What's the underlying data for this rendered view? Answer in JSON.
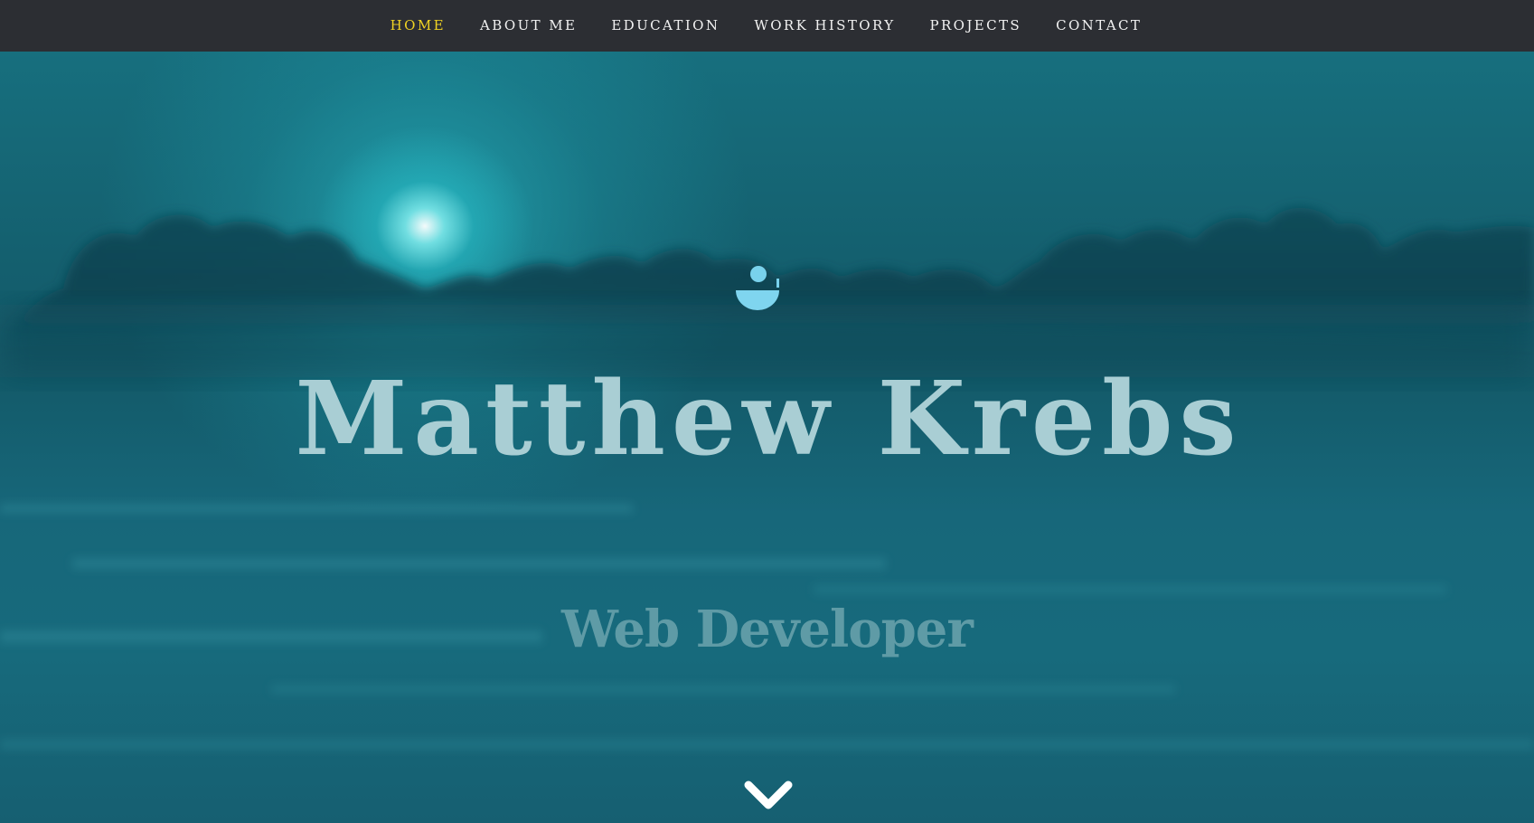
{
  "nav": {
    "items": [
      {
        "label": "HOME",
        "active": true
      },
      {
        "label": "ABOUT ME",
        "active": false
      },
      {
        "label": "EDUCATION",
        "active": false
      },
      {
        "label": "WORK HISTORY",
        "active": false
      },
      {
        "label": "PROJECTS",
        "active": false
      },
      {
        "label": "CONTACT",
        "active": false
      }
    ]
  },
  "hero": {
    "title": "Matthew Krebs",
    "subtitle": "Web Developer",
    "logo_icon": "sun-over-bowl-icon",
    "scroll_icon": "chevron-down-icon"
  },
  "colors": {
    "nav_bg": "#2c2e33",
    "nav_active": "#f0d323",
    "nav_text": "#f2f2f2",
    "hero_bg": "#176a7c",
    "title": "#a9ced4",
    "subtitle": "#5f9ba6"
  }
}
